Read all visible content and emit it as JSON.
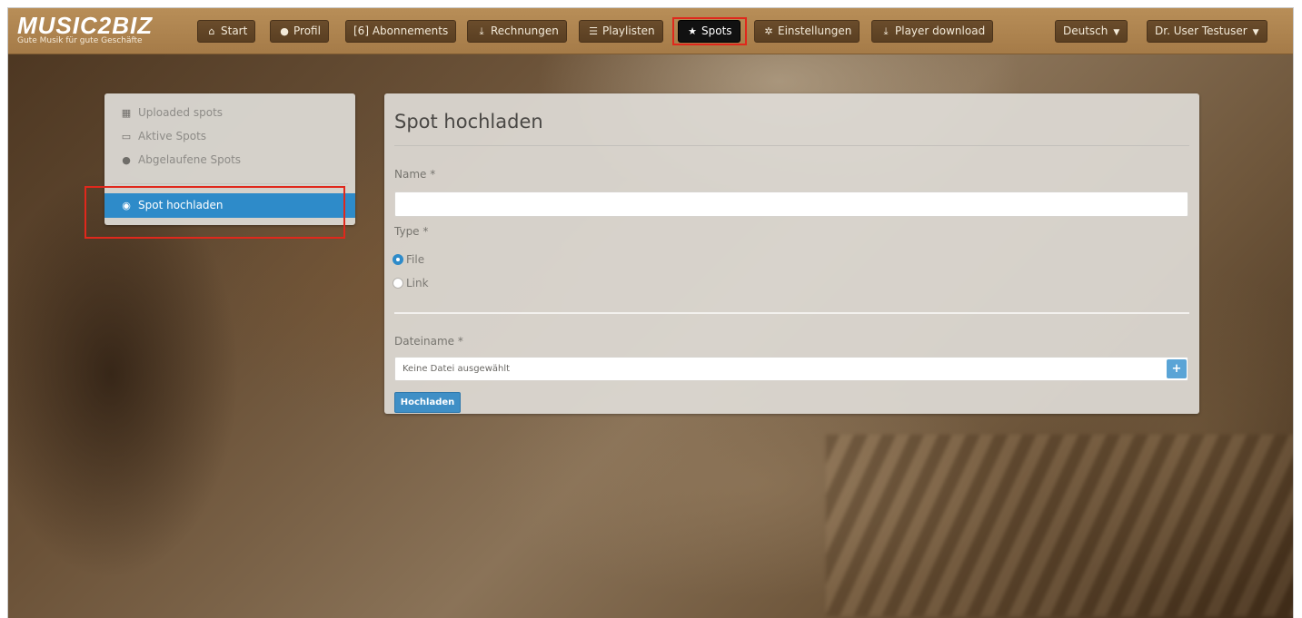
{
  "brand": {
    "name": "MUSIC2BIZ",
    "tagline": "Gute Musik für gute Geschäfte"
  },
  "nav": {
    "start": "Start",
    "profil": "Profil",
    "abonnements": "Abonnements",
    "abonnements_icon_text": "[6]",
    "rechnungen": "Rechnungen",
    "playlisten": "Playlisten",
    "spots": "Spots",
    "einstellungen": "Einstellungen",
    "player_download": "Player download",
    "language": "Deutsch",
    "user": "Dr. User Testuser",
    "active_item": "spots"
  },
  "sidebar": {
    "items": [
      {
        "label": "Uploaded spots",
        "icon": "calendar-icon"
      },
      {
        "label": "Aktive Spots",
        "icon": "card-icon"
      },
      {
        "label": "Abgelaufene Spots",
        "icon": "info-circle-icon"
      }
    ],
    "active": {
      "label": "Spot hochladen",
      "icon": "upload-circle-icon"
    }
  },
  "form": {
    "title": "Spot hochladen",
    "name_label": "Name *",
    "name_value": "",
    "type_label": "Type *",
    "type_options": [
      "File",
      "Link"
    ],
    "type_selected": "File",
    "filename_label": "Dateiname *",
    "file_placeholder": "Keine Datei ausgewählt",
    "add_symbol": "+",
    "submit_label": "Hochladen"
  },
  "colors": {
    "navbar": "#a57b48",
    "button": "#5a3f22",
    "active_nav": "#111111",
    "accent_blue": "#2e8bc9",
    "highlight_red": "#e0281c"
  }
}
